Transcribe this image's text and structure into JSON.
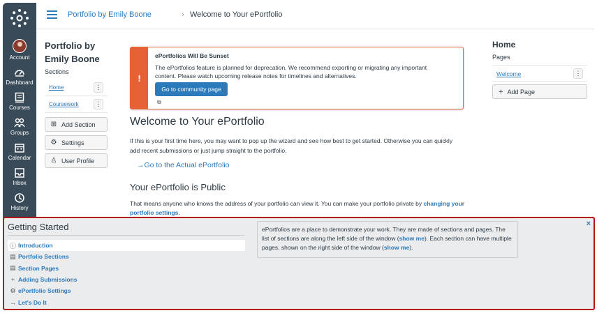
{
  "nav": {
    "items": [
      {
        "label": "Account",
        "icon": "account-avatar"
      },
      {
        "label": "Dashboard",
        "icon": "dashboard-icon"
      },
      {
        "label": "Courses",
        "icon": "courses-icon"
      },
      {
        "label": "Groups",
        "icon": "groups-icon"
      },
      {
        "label": "Calendar",
        "icon": "calendar-icon"
      },
      {
        "label": "Inbox",
        "icon": "inbox-icon"
      },
      {
        "label": "History",
        "icon": "history-icon"
      }
    ]
  },
  "breadcrumb": {
    "parent": "Portfolio by Emily Boone",
    "separator": "›",
    "current": "Welcome to Your ePortfolio"
  },
  "portfolio": {
    "title": "Portfolio by Emily Boone",
    "sections_label": "Sections",
    "sections": [
      "Home",
      "Coursework"
    ],
    "add_section": "Add Section",
    "settings": "Settings",
    "user_profile": "User Profile"
  },
  "alert": {
    "icon": "!",
    "title": "ePortfolios Will Be Sunset",
    "body": "The ePortfolios feature is planned for deprecation. We recommend exporting or migrating any important content. Please watch upcoming release notes for timelines and alternatives.",
    "button": "Go to community page"
  },
  "main": {
    "heading": "Welcome to Your ePortfolio",
    "intro": "If this is your first time here, you may want to pop up the wizard and see how best to get started. Otherwise you can quickly add recent submissions or just jump straight to the portfolio.",
    "actual_link": "Go to the Actual ePortfolio",
    "public_heading": "Your ePortfolio is Public",
    "public_text": "That means anyone who knows the address of your portfolio can view it. You can make your portfolio private by ",
    "public_link": "changing your portfolio settings",
    "public_end": "."
  },
  "right": {
    "heading": "Home",
    "pages_label": "Pages",
    "pages": [
      "Welcome"
    ],
    "add_page": "Add Page"
  },
  "getting_started": {
    "title": "Getting Started",
    "items": [
      {
        "label": "Introduction",
        "icon": "info-icon"
      },
      {
        "label": "Portfolio Sections",
        "icon": "document-icon"
      },
      {
        "label": "Section Pages",
        "icon": "document-icon"
      },
      {
        "label": "Adding Submissions",
        "icon": "plus-icon"
      },
      {
        "label": "ePortfolio Settings",
        "icon": "gear-icon"
      },
      {
        "label": "Let's Do It",
        "icon": "arrow-right-icon"
      }
    ],
    "text_1": "ePortfolios are a place to demonstrate your work. They are made of sections and pages. The list of sections are along the left side of the window (",
    "show_me_1": "show me",
    "text_2": "). Each section can have multiple pages, shown on the right side of the window (",
    "show_me_2": "show me",
    "text_3": ").",
    "close": "×"
  },
  "colors": {
    "nav_bg": "#394b58",
    "link": "#2b7abc",
    "alert": "#e66135",
    "highlight_border": "#b3141b"
  }
}
